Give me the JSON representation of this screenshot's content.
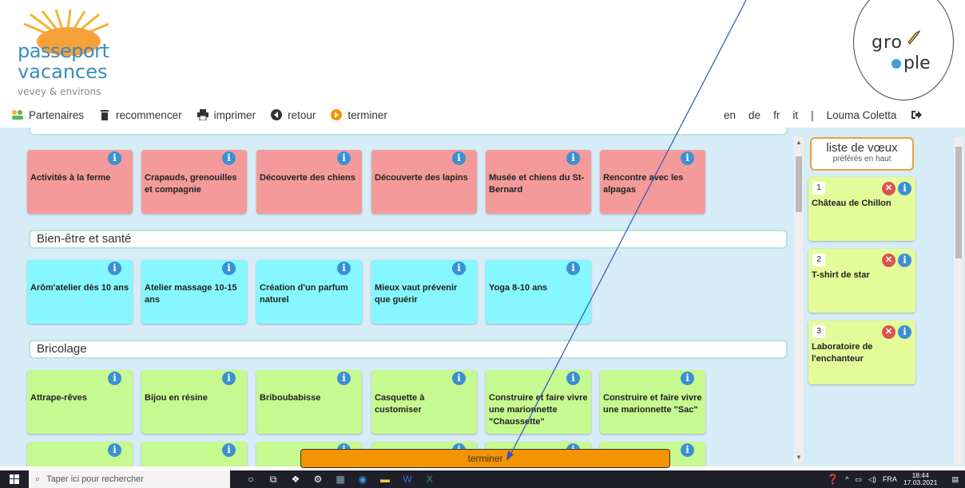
{
  "logo": {
    "line1": "passeport",
    "line2": "vacances",
    "line3": "vevey & environs"
  },
  "brand": {
    "line1": "gro",
    "line2": "ple"
  },
  "nav": {
    "partenaires": "Partenaires",
    "recommencer": "recommencer",
    "imprimer": "imprimer",
    "retour": "retour",
    "terminer": "terminer"
  },
  "lang": {
    "en": "en",
    "de": "de",
    "fr": "fr",
    "it": "it",
    "sep": "|",
    "user": "Louma Coletta"
  },
  "sections": {
    "animaux": {
      "cards": [
        "Activités à la ferme",
        "Crapauds, grenouilles et compagnie",
        "Découverte des chiens",
        "Découverte des lapins",
        "Musée et chiens du St-Bernard",
        "Rencontre avec les alpagas"
      ]
    },
    "bienetre": {
      "title": "Bien-être et santé",
      "cards": [
        "Arôm'atelier dès 10 ans",
        "Atelier massage 10-15 ans",
        "Création d'un parfum naturel",
        "Mieux vaut prévenir que guérir",
        "Yoga 8-10 ans"
      ]
    },
    "bricolage": {
      "title": "Bricolage",
      "cards": [
        "Attrape-rêves",
        "Bijou en résine",
        "Briboubabisse",
        "Casquette à customiser",
        "Construire et faire vivre une marionnette \"Chaussette\"",
        "Construire et faire vivre une marionnette \"Sac\""
      ]
    }
  },
  "wishlist": {
    "title": "liste de vœux",
    "subtitle": "préférés en haut",
    "items": [
      {
        "rank": "1",
        "title": "Château de Chillon"
      },
      {
        "rank": "2",
        "title": "T-shirt de star"
      },
      {
        "rank": "3",
        "title": "Laboratoire de l'enchanteur"
      }
    ]
  },
  "bottom_button": "terminer",
  "taskbar": {
    "search_placeholder": "Taper ici pour rechercher",
    "lang": "FRA",
    "time": "18:44",
    "date": "17.03.2021"
  },
  "colors": {
    "animaux": "#f49a9a",
    "bienetre": "#86f7ff",
    "bricolage": "#c7f991",
    "wish": "#e4fb9a",
    "accent": "#f39400",
    "info": "#3b8fd6"
  }
}
